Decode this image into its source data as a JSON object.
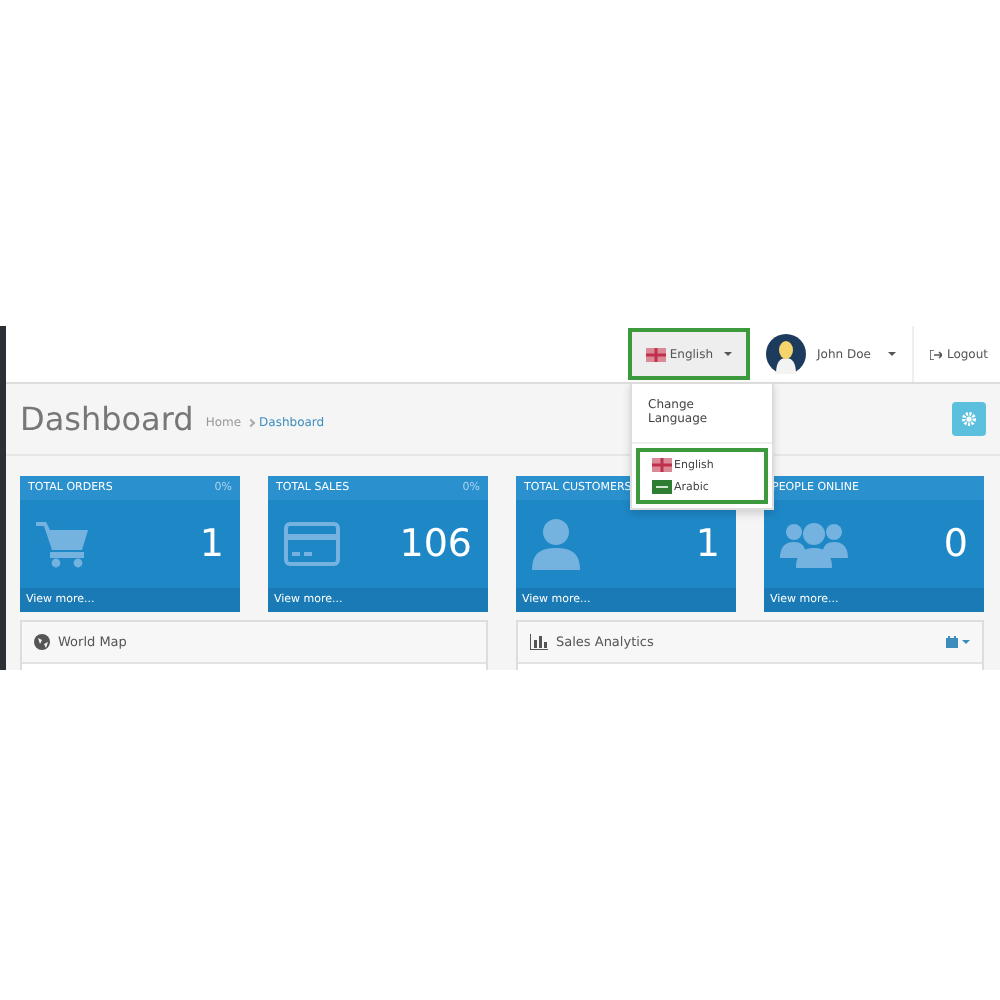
{
  "navbar": {
    "language_button": {
      "label": "English",
      "expanded": true
    },
    "user_menu": {
      "label": "John Doe"
    },
    "logout": {
      "label": "Logout"
    }
  },
  "language_menu": {
    "header": "Change Language",
    "items": [
      {
        "label": "English",
        "kind": "uk"
      },
      {
        "label": "Arabic",
        "kind": "sa"
      }
    ]
  },
  "page": {
    "title": "Dashboard",
    "breadcrumb": [
      "Home",
      "Dashboard"
    ]
  },
  "stat_cards": [
    {
      "title": "TOTAL ORDERS",
      "percent": "0%",
      "value": "1",
      "kind": "cart",
      "link": "View more..."
    },
    {
      "title": "TOTAL SALES",
      "percent": "0%",
      "value": "106",
      "kind": "card",
      "link": "View more..."
    },
    {
      "title": "TOTAL CUSTOMERS",
      "value": "1",
      "kind": "user",
      "link": "View more..."
    },
    {
      "title": "PEOPLE ONLINE",
      "value": "0",
      "kind": "users",
      "link": "View more..."
    }
  ],
  "panels": [
    {
      "title": "World Map",
      "kind": "globe"
    },
    {
      "title": "Sales Analytics",
      "kind": "chart"
    }
  ]
}
